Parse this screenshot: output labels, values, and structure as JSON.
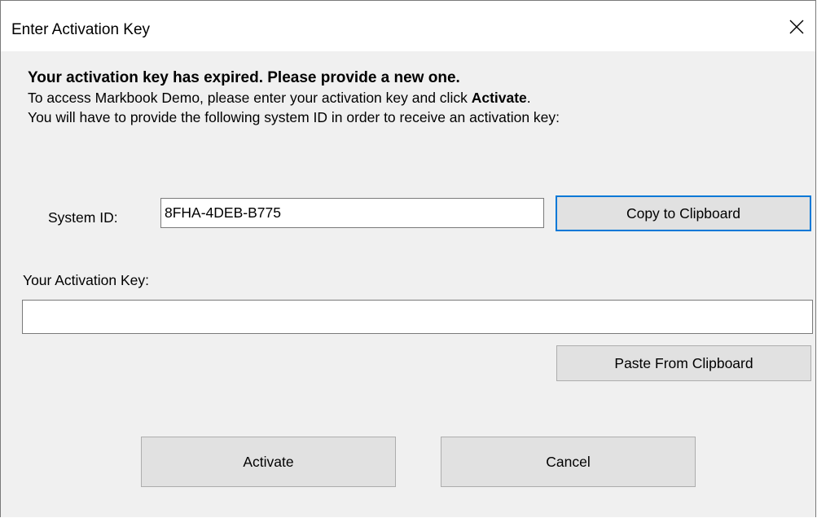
{
  "window": {
    "title": "Enter Activation Key",
    "close_icon": "close-icon"
  },
  "message": {
    "heading": "Your activation key has expired. Please provide a new one.",
    "line1_prefix": "To access Markbook Demo, please enter your activation key and click ",
    "line1_bold": "Activate",
    "line1_suffix": ".",
    "line2": "You will have to provide the following system ID in order to receive an activation key:"
  },
  "system_id": {
    "label": "System ID:",
    "value": "8FHA-4DEB-B775",
    "copy_button": "Copy to Clipboard"
  },
  "activation_key": {
    "label": "Your Activation Key:",
    "value": "",
    "paste_button": "Paste From Clipboard"
  },
  "actions": {
    "activate": "Activate",
    "cancel": "Cancel"
  },
  "colors": {
    "dialog_bg": "#f0f0f0",
    "titlebar_bg": "#ffffff",
    "button_bg": "#e1e1e1",
    "button_border": "#adadad",
    "focus_accent": "#0078d7"
  }
}
